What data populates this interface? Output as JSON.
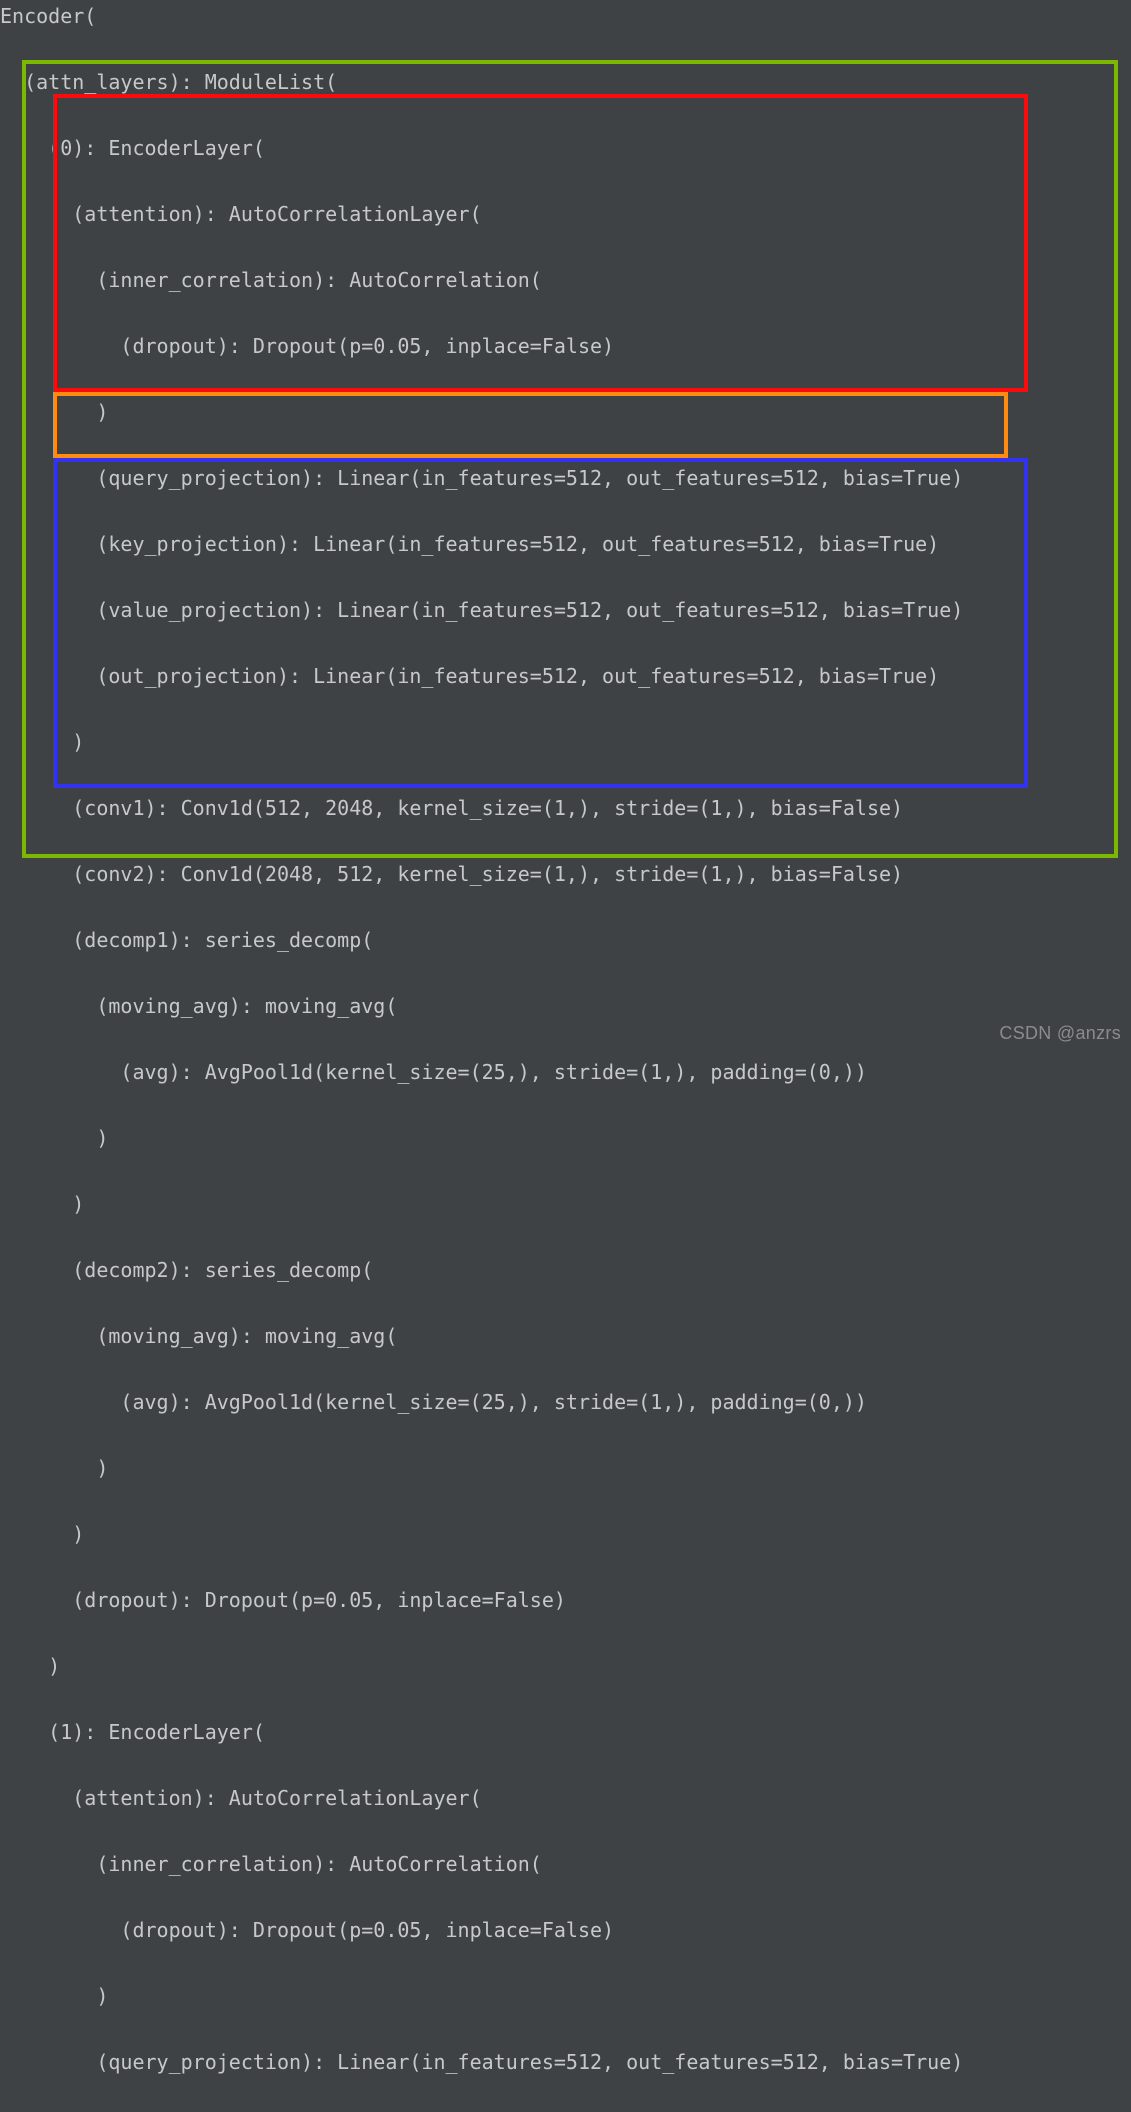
{
  "lines": {
    "l00": "Encoder(",
    "l01": "  (attn_layers): ModuleList(",
    "l02": "    (0): EncoderLayer(",
    "l03": "      (attention): AutoCorrelationLayer(",
    "l04": "        (inner_correlation): AutoCorrelation(",
    "l05": "          (dropout): Dropout(p=0.05, inplace=False)",
    "l06": "        )",
    "l07": "        (query_projection): Linear(in_features=512, out_features=512, bias=True)",
    "l08": "        (key_projection): Linear(in_features=512, out_features=512, bias=True)",
    "l09": "        (value_projection): Linear(in_features=512, out_features=512, bias=True)",
    "l10": "        (out_projection): Linear(in_features=512, out_features=512, bias=True)",
    "l11": "      )",
    "l12": "      (conv1): Conv1d(512, 2048, kernel_size=(1,), stride=(1,), bias=False)",
    "l13": "      (conv2): Conv1d(2048, 512, kernel_size=(1,), stride=(1,), bias=False)",
    "l14": "      (decomp1): series_decomp(",
    "l15": "        (moving_avg): moving_avg(",
    "l16": "          (avg): AvgPool1d(kernel_size=(25,), stride=(1,), padding=(0,))",
    "l17": "        )",
    "l18": "      )",
    "l19": "      (decomp2): series_decomp(",
    "l20": "        (moving_avg): moving_avg(",
    "l21": "          (avg): AvgPool1d(kernel_size=(25,), stride=(1,), padding=(0,))",
    "l22": "        )",
    "l23": "      )",
    "l24": "      (dropout): Dropout(p=0.05, inplace=False)",
    "l25": "    )",
    "l26": "    (1): EncoderLayer(",
    "l27": "      (attention): AutoCorrelationLayer(",
    "l28": "        (inner_correlation): AutoCorrelation(",
    "l29": "          (dropout): Dropout(p=0.05, inplace=False)",
    "l30": "        )",
    "l31": "        (query_projection): Linear(in_features=512, out_features=512, bias=True)"
  },
  "watermark": "CSDN @anzrs",
  "colors": {
    "bg": "#3e4245",
    "text": "#c6c8c9",
    "green": "#7cb800",
    "red": "#fa0b0c",
    "orange": "#ff8b12",
    "blue": "#3232ef"
  }
}
